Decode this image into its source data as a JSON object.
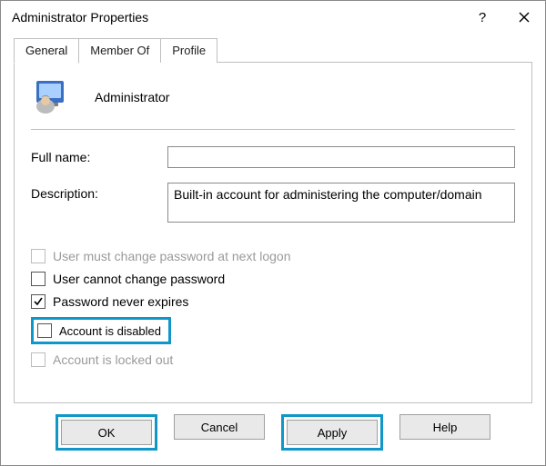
{
  "window": {
    "title": "Administrator Properties"
  },
  "tabs": {
    "general": "General",
    "member_of": "Member Of",
    "profile": "Profile"
  },
  "header": {
    "username": "Administrator"
  },
  "form": {
    "full_name_label": "Full name:",
    "full_name_value": "",
    "description_label": "Description:",
    "description_value": "Built-in account for administering the computer/domain"
  },
  "checkboxes": {
    "must_change": {
      "label": "User must change password at next logon",
      "checked": false,
      "enabled": false
    },
    "cannot_change": {
      "label": "User cannot change password",
      "checked": false,
      "enabled": true
    },
    "never_expires": {
      "label": "Password never expires",
      "checked": true,
      "enabled": true
    },
    "disabled": {
      "label": "Account is disabled",
      "checked": false,
      "enabled": true,
      "highlighted": true
    },
    "locked_out": {
      "label": "Account is locked out",
      "checked": false,
      "enabled": false
    }
  },
  "buttons": {
    "ok": "OK",
    "cancel": "Cancel",
    "apply": "Apply",
    "help": "Help"
  }
}
